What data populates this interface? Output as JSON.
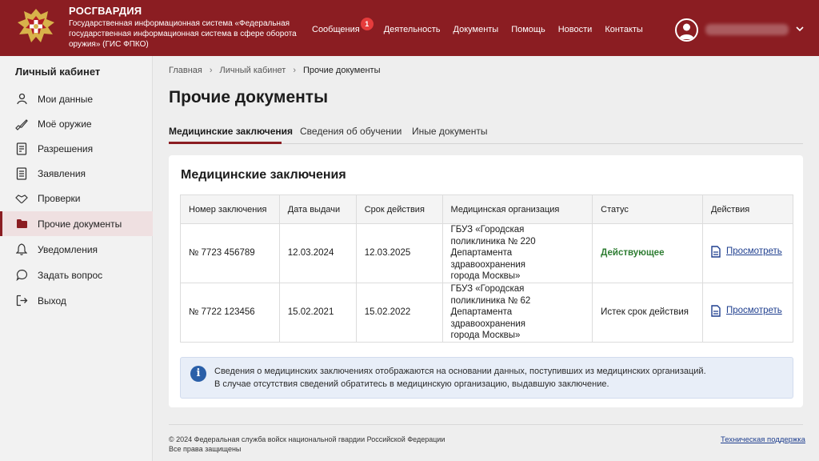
{
  "colors": {
    "brand": "#8b1d22",
    "active_status": "#2e7d32",
    "link": "#1f3f8f",
    "info_bg": "#e8eef8"
  },
  "header": {
    "brand_name": "РОСГВАРДИЯ",
    "brand_subtitle": "Государственная информационная система «Федеральная государственная информационная система в сфере оборота оружия» (ГИС ФПКО)",
    "nav": [
      {
        "label": "Сообщения",
        "badge": "1"
      },
      {
        "label": "Деятельность"
      },
      {
        "label": "Документы"
      },
      {
        "label": "Помощь"
      },
      {
        "label": "Новости"
      },
      {
        "label": "Контакты"
      }
    ],
    "user_icon": "user-avatar-icon"
  },
  "sidebar": {
    "title": "Личный кабинет",
    "items": [
      {
        "label": "Мои данные",
        "icon": "person-icon"
      },
      {
        "label": "Моё оружие",
        "icon": "rifle-icon"
      },
      {
        "label": "Разрешения",
        "icon": "document-check-icon"
      },
      {
        "label": "Заявления",
        "icon": "document-list-icon"
      },
      {
        "label": "Проверки",
        "icon": "handshake-icon"
      },
      {
        "label": "Прочие документы",
        "icon": "folder-icon",
        "active": true
      },
      {
        "label": "Уведомления",
        "icon": "bell-icon"
      },
      {
        "label": "Задать вопрос",
        "icon": "chat-icon"
      },
      {
        "label": "Выход",
        "icon": "logout-icon"
      }
    ]
  },
  "breadcrumb": [
    "Главная",
    "Личный кабинет",
    "Прочие документы"
  ],
  "page_title": "Прочие документы",
  "tabs": [
    {
      "label": "Медицинские заключения",
      "active": true
    },
    {
      "label": "Сведения об обучении"
    },
    {
      "label": "Иные документы"
    }
  ],
  "section": {
    "title": "Медицинские заключения",
    "columns": [
      "Номер заключения",
      "Дата выдачи",
      "Срок действия",
      "Медицинская организация",
      "Статус",
      "Действия"
    ],
    "rows": [
      {
        "number": "№ 7723 456789",
        "issued": "12.03.2024",
        "valid_until": "12.03.2025",
        "organization": [
          "ГБУЗ «Городская",
          "поликлиника № 220",
          "Департамента здравоохранения",
          "города Москвы»"
        ],
        "status": "Действующее",
        "status_type": "active",
        "action": "Просмотреть"
      },
      {
        "number": "№ 7722 123456",
        "issued": "15.02.2021",
        "valid_until": "15.02.2022",
        "organization": [
          "ГБУЗ «Городская",
          "поликлиника № 62",
          "Департамента здравоохранения",
          "города Москвы»"
        ],
        "status": "Истек срок действия",
        "status_type": "expired",
        "action": "Просмотреть"
      }
    ],
    "info_lines": [
      "Сведения о медицинских заключениях отображаются на основании данных, поступивших из медицинских организаций.",
      "В случае отсутствия сведений обратитесь в медицинскую организацию, выдавшую заключение."
    ]
  },
  "footer": {
    "copyright": "© 2024 Федеральная служба войск национальной гвардии Российской Федерации",
    "rights": "Все права защищены",
    "support_link": "Техническая поддержка"
  }
}
